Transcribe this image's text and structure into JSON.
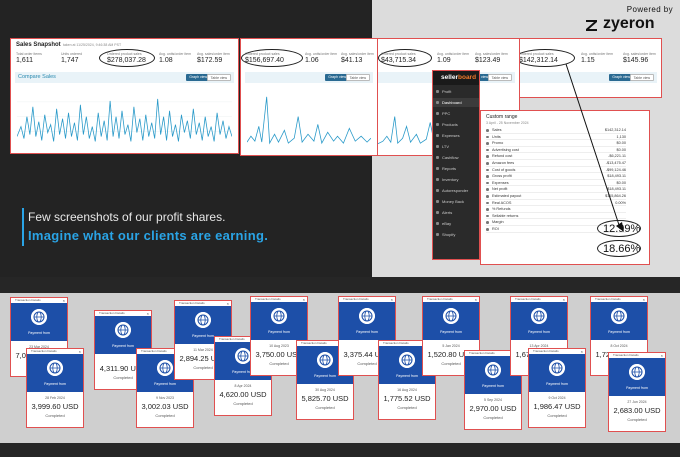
{
  "brand": {
    "powered": "Powered by",
    "name": "zyeron"
  },
  "tagline": {
    "line1": "Few screenshots of our profit shares.",
    "line2": "Imagine what our clients are earning."
  },
  "panel1": {
    "title": "Sales Snapshot",
    "subtitle": "taken at 11/25/2024, 9:46:38 AM PST",
    "stats": [
      {
        "label": "Total order items",
        "value": "1,611"
      },
      {
        "label": "Units ordered",
        "value": "1,747"
      },
      {
        "label": "Ordered product sales",
        "value": "$278,037.28"
      },
      {
        "label": "Avg. units/order item",
        "value": "1.08"
      },
      {
        "label": "Avg. sales/order item",
        "value": "$172.59"
      }
    ],
    "compare": "Compare Sales",
    "graph_btn": "Graph view",
    "table_btn": "Table view"
  },
  "panel2": {
    "stats": [
      {
        "label": "Ordered product sales",
        "value": "$156,697.40"
      },
      {
        "label": "Avg. units/order item",
        "value": "1.06"
      },
      {
        "label": "Avg. sales/order item",
        "value": "$41.13"
      }
    ],
    "graph_btn": "Graph view",
    "table_btn": "Table view"
  },
  "panel3": {
    "stats": [
      {
        "label": "Ordered product sales",
        "value": "$43,715.34"
      },
      {
        "label": "Avg. units/order item",
        "value": "1.09"
      },
      {
        "label": "Avg. sales/order item",
        "value": "$123.49"
      }
    ],
    "graph_btn": "Graph view",
    "table_btn": "Table view"
  },
  "panel4": {
    "stats": [
      {
        "label": "Ordered product sales",
        "value": "$142,312.14"
      },
      {
        "label": "Avg. units/order item",
        "value": "1.15"
      },
      {
        "label": "Avg. sales/order item",
        "value": "$145.96"
      }
    ],
    "graph_btn": "Graph view",
    "table_btn": "Table view"
  },
  "sidebar": {
    "logo_a": "seller",
    "logo_b": "board",
    "items": [
      "Profit",
      "Dashboard",
      "PPC",
      "Products",
      "Expenses",
      "LTV",
      "Cashflow",
      "Reports",
      "Inventory",
      "Autoresponder",
      "Money Back",
      "Alerts",
      "eBay",
      "Shopify"
    ]
  },
  "range": {
    "title": "Custom range",
    "subtitle": "3 April - 25 November 2024",
    "rows": [
      {
        "label": "Sales",
        "value": "$142,312.14"
      },
      {
        "label": "Units",
        "value": "1,130"
      },
      {
        "label": "Promo",
        "value": "$0.00"
      },
      {
        "label": "Advertising cost",
        "value": "$0.00"
      },
      {
        "label": "Refund cost",
        "value": "-$6,221.11"
      },
      {
        "label": "Amazon fees",
        "value": "-$13,475.47"
      },
      {
        "label": "Cost of goods",
        "value": "-$99,124.46"
      },
      {
        "label": "Gross profit",
        "value": "$18,493.11"
      },
      {
        "label": "Expenses",
        "value": "$0.00"
      },
      {
        "label": "Net profit",
        "value": "$18,493.11"
      },
      {
        "label": "Estimated payout",
        "value": "$115,864.26"
      },
      {
        "label": "Real ACOS",
        "value": "0.00%"
      },
      {
        "label": "% Refunds",
        "value": ""
      },
      {
        "label": "Sellable returns",
        "value": ""
      },
      {
        "label": "Margin",
        "value": ""
      },
      {
        "label": "ROI",
        "value": ""
      }
    ],
    "margin_pct": "12.99%",
    "roi_pct": "18.66%"
  },
  "cards": [
    {
      "head": "Transaction Details",
      "from": "Payment from",
      "date": "23 Mar 2024",
      "amount": "7,000.00 USD",
      "status": "Completed"
    },
    {
      "head": "Transaction Details",
      "from": "Payment from",
      "date": "28 Feb 2024",
      "amount": "3,999.60 USD",
      "status": "Completed"
    },
    {
      "head": "Transaction Details",
      "from": "Payment from",
      "date": "",
      "amount": "4,311.90 USD",
      "status": "Completed"
    },
    {
      "head": "Transaction Details",
      "from": "Payment from",
      "date": "9 Nov 2023",
      "amount": "3,002.03 USD",
      "status": "Completed"
    },
    {
      "head": "Transaction Details",
      "from": "Payment from",
      "date": "11 Mar 2024",
      "amount": "2,894.25 USD",
      "status": "Completed"
    },
    {
      "head": "Transaction Details",
      "from": "Payment from",
      "date": "8 Apr 2024",
      "amount": "4,620.00 USD",
      "status": "Completed"
    },
    {
      "head": "Transaction Details",
      "from": "Payment from",
      "date": "10 Aug 2023",
      "amount": "3,750.00 USD",
      "status": "Completed"
    },
    {
      "head": "Transaction Details",
      "from": "Payment from",
      "date": "30 Aug 2024",
      "amount": "5,825.70 USD",
      "status": "Completed"
    },
    {
      "head": "Transaction Details",
      "from": "Payment from",
      "date": "",
      "amount": "3,375.44 USD",
      "status": "Completed"
    },
    {
      "head": "Transaction Details",
      "from": "Payment from",
      "date": "16 Aug 2024",
      "amount": "1,775.52 USD",
      "status": "Completed"
    },
    {
      "head": "Transaction Details",
      "from": "Payment from",
      "date": "5 Jan 2024",
      "amount": "1,520.80 USD",
      "status": "Completed"
    },
    {
      "head": "Transaction Details",
      "from": "Payment from",
      "date": "5 Sep 2024",
      "amount": "2,970.00 USD",
      "status": "Completed"
    },
    {
      "head": "Transaction Details",
      "from": "Payment from",
      "date": "13 Apr 2024",
      "amount": "1,675.67 USD",
      "status": "Completed"
    },
    {
      "head": "Transaction Details",
      "from": "Payment from",
      "date": "9 Oct 2024",
      "amount": "1,986.47 USD",
      "status": "Completed"
    },
    {
      "head": "Transaction Details",
      "from": "Payment from",
      "date": "8 Oct 2024",
      "amount": "1,724.47 USD",
      "status": "Completed"
    },
    {
      "head": "Transaction Details",
      "from": "Payment from",
      "date": "27 Jun 2024",
      "amount": "2,683.00 USD",
      "status": "Completed"
    }
  ]
}
